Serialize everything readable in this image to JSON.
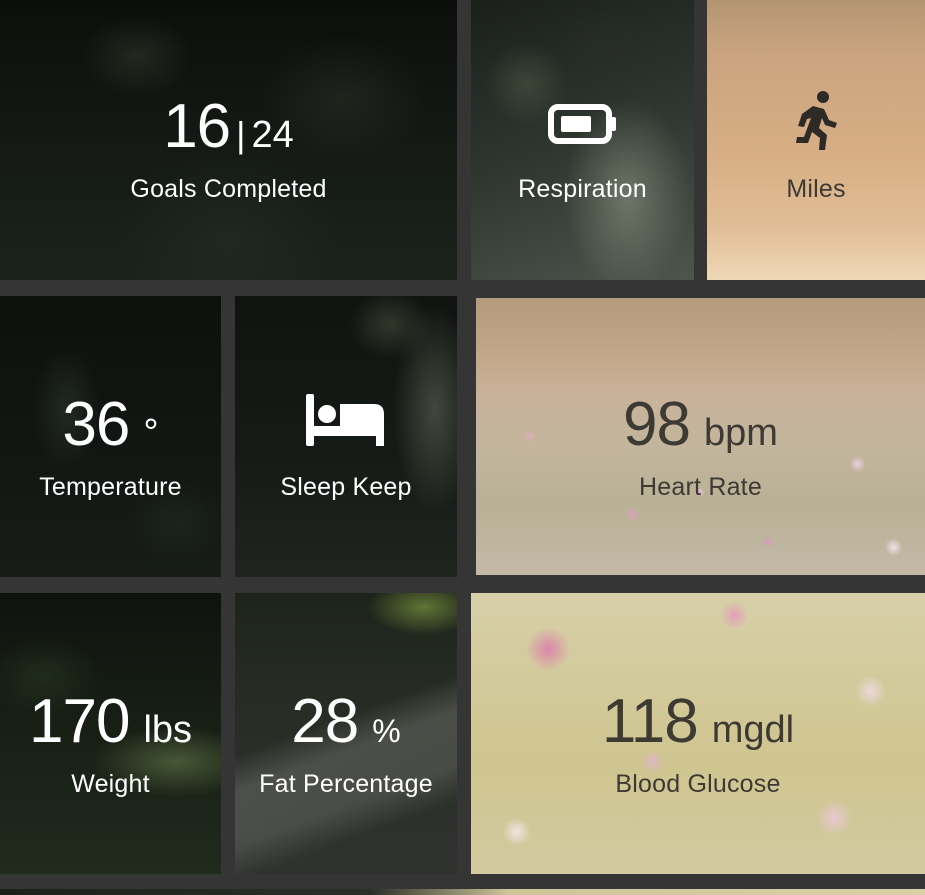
{
  "tiles": {
    "goals": {
      "value": "16",
      "separator": "|",
      "total": "24",
      "label": "Goals Completed"
    },
    "respiration": {
      "label": "Respiration",
      "icon": "battery-icon"
    },
    "miles": {
      "label": "Miles",
      "icon": "running-icon"
    },
    "temperature": {
      "value": "36",
      "unit": "°",
      "label": "Temperature"
    },
    "sleep": {
      "label": "Sleep Keep",
      "icon": "bed-icon"
    },
    "heart_rate": {
      "value": "98",
      "unit": "bpm",
      "label": "Heart Rate"
    },
    "weight": {
      "value": "170",
      "unit": "lbs",
      "label": "Weight"
    },
    "fat": {
      "value": "28",
      "unit": "%",
      "label": "Fat Percentage"
    },
    "glucose": {
      "value": "118",
      "unit": "mgdl",
      "label": "Blood Glucose"
    }
  },
  "colors": {
    "gutter": "#353535",
    "light_text": "#ffffff",
    "dark_text": "#3d3a34"
  }
}
